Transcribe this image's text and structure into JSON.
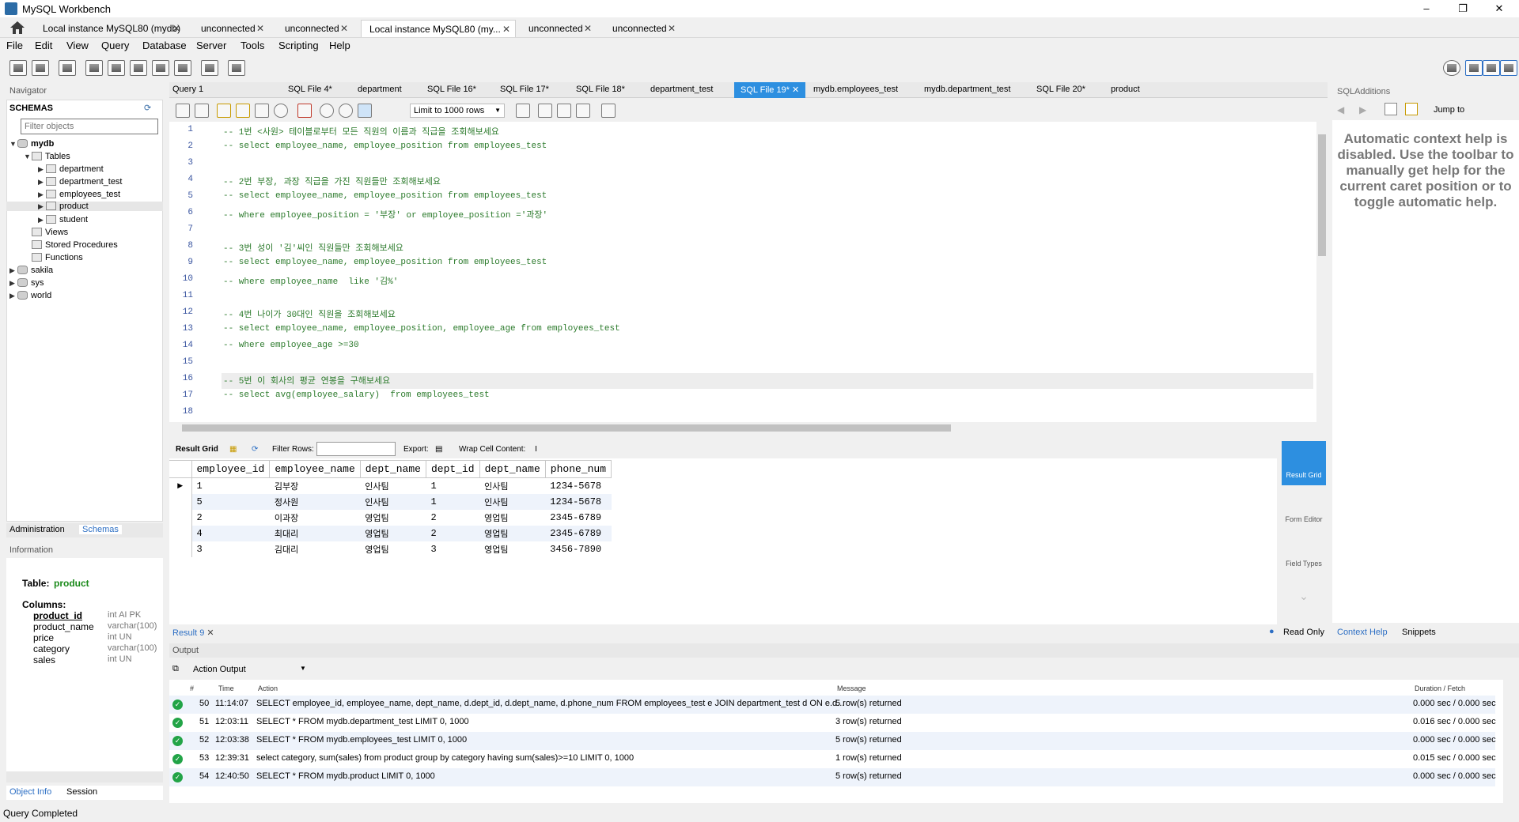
{
  "window": {
    "title": "MySQL Workbench",
    "minimize": "–",
    "maximize": "❐",
    "close": "✕"
  },
  "connection_tabs": [
    {
      "label": "Local instance MySQL80 (mydb)",
      "active": false
    },
    {
      "label": "unconnected",
      "active": false
    },
    {
      "label": "unconnected",
      "active": false
    },
    {
      "label": "Local instance MySQL80 (my...",
      "active": true
    },
    {
      "label": "unconnected",
      "active": false
    },
    {
      "label": "unconnected",
      "active": false
    }
  ],
  "menu": [
    "File",
    "Edit",
    "View",
    "Query",
    "Database",
    "Server",
    "Tools",
    "Scripting",
    "Help"
  ],
  "navigator": {
    "title": "Navigator",
    "schemas_label": "SCHEMAS",
    "filter_placeholder": "Filter objects",
    "tree": {
      "db": "mydb",
      "tables_label": "Tables",
      "tables": [
        "department",
        "department_test",
        "employees_test",
        "product",
        "student"
      ],
      "views": "Views",
      "procs": "Stored Procedures",
      "funcs": "Functions",
      "others": [
        "sakila",
        "sys",
        "world"
      ]
    },
    "tabs": [
      "Administration",
      "Schemas"
    ],
    "info_title": "Information",
    "info": {
      "table_label": "Table:",
      "table_name": "product",
      "columns_label": "Columns:",
      "columns": [
        {
          "name": "product_id",
          "type": "int AI PK"
        },
        {
          "name": "product_name",
          "type": "varchar(100)"
        },
        {
          "name": "price",
          "type": "int UN"
        },
        {
          "name": "category",
          "type": "varchar(100)"
        },
        {
          "name": "sales",
          "type": "int UN"
        }
      ]
    },
    "bottom_tabs": [
      "Object Info",
      "Session"
    ]
  },
  "sql_tabs": [
    "Query 1",
    "SQL File 4*",
    "department",
    "SQL File 16*",
    "SQL File 17*",
    "SQL File 18*",
    "department_test",
    "SQL File 19*",
    "mydb.employees_test",
    "mydb.department_test",
    "SQL File 20*",
    "product"
  ],
  "active_sql_tab_index": 7,
  "editor_toolbar": {
    "limit": "Limit to 1000 rows"
  },
  "editor": {
    "lines": [
      "-- 1번 <사원> 테이블로부터 모든 직원의 이름과 직급을 조회해보세요",
      "-- select employee_name, employee_position from employees_test",
      "",
      "-- 2번 부장, 과장 직급을 가진 직원들만 조회해보세요",
      "-- select employee_name, employee_position from employees_test",
      "-- where employee_position = '부장' or employee_position ='과장'",
      "",
      "-- 3번 성이 '김'씨인 직원들만 조회해보세요",
      "-- select employee_name, employee_position from employees_test",
      "-- where employee_name  like '김%'",
      "",
      "-- 4번 나이가 30대인 직원을 조회해보세요",
      "-- select employee_name, employee_position, employee_age from employees_test",
      "-- where employee_age >=30",
      "",
      "-- 5번 이 회사의 평균 연봉을 구해보세요",
      "-- select avg(employee_salary)  from employees_test",
      ""
    ],
    "highlight_line": 16
  },
  "result_toolbar": {
    "grid_label": "Result Grid",
    "filter_label": "Filter Rows:",
    "export_label": "Export:",
    "wrap_label": "Wrap Cell Content:"
  },
  "result_grid": {
    "columns": [
      "employee_id",
      "employee_name",
      "dept_name",
      "dept_id",
      "dept_name",
      "phone_num"
    ],
    "rows": [
      [
        "1",
        "김부장",
        "인사팀",
        "1",
        "인사팀",
        "1234-5678"
      ],
      [
        "5",
        "정사원",
        "인사팀",
        "1",
        "인사팀",
        "1234-5678"
      ],
      [
        "2",
        "이과장",
        "영업팀",
        "2",
        "영업팀",
        "2345-6789"
      ],
      [
        "4",
        "최대리",
        "영업팀",
        "2",
        "영업팀",
        "2345-6789"
      ],
      [
        "3",
        "김대리",
        "영업팀",
        "3",
        "영업팀",
        "3456-7890"
      ]
    ]
  },
  "side_buttons": [
    {
      "label": "Result Grid",
      "active": true
    },
    {
      "label": "Form Editor",
      "active": false
    },
    {
      "label": "Field Types",
      "active": false
    }
  ],
  "result_tab": "Result 9",
  "read_only": "Read Only",
  "output": {
    "title": "Output",
    "mode": "Action Output",
    "headers": [
      "#",
      "Time",
      "Action",
      "Message",
      "Duration / Fetch"
    ],
    "rows": [
      {
        "n": "50",
        "time": "11:14:07",
        "action": "SELECT employee_id, employee_name, dept_name, d.dept_id, d.dept_name, d.phone_num  FROM employees_test e JOIN department_test d  ON e.d...",
        "message": "5 row(s) returned",
        "duration": "0.000 sec / 0.000 sec"
      },
      {
        "n": "51",
        "time": "12:03:11",
        "action": "SELECT * FROM mydb.department_test LIMIT 0, 1000",
        "message": "3 row(s) returned",
        "duration": "0.016 sec / 0.000 sec"
      },
      {
        "n": "52",
        "time": "12:03:38",
        "action": "SELECT * FROM mydb.employees_test LIMIT 0, 1000",
        "message": "5 row(s) returned",
        "duration": "0.000 sec / 0.000 sec"
      },
      {
        "n": "53",
        "time": "12:39:31",
        "action": "select category, sum(sales) from product group by category having sum(sales)>=10 LIMIT 0, 1000",
        "message": "1 row(s) returned",
        "duration": "0.015 sec / 0.000 sec"
      },
      {
        "n": "54",
        "time": "12:40:50",
        "action": "SELECT * FROM mydb.product LIMIT 0, 1000",
        "message": "5 row(s) returned",
        "duration": "0.000 sec / 0.000 sec"
      }
    ]
  },
  "sql_additions": {
    "title": "SQLAdditions",
    "jump_to": "Jump to",
    "help_text": "Automatic context help is disabled. Use the toolbar to manually get help for the current caret position or to toggle automatic help.",
    "tabs": [
      "Context Help",
      "Snippets"
    ]
  },
  "status": "Query Completed"
}
